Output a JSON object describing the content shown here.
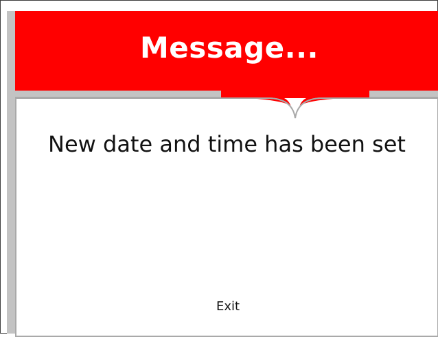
{
  "dialog": {
    "title": "Message...",
    "message": "New date and time has been set",
    "exit_label": "Exit"
  },
  "colors": {
    "header_background": "#ff0000",
    "header_text": "#ffffff",
    "panel_border": "#a9a9a9",
    "frame": "#c3c3c3"
  }
}
